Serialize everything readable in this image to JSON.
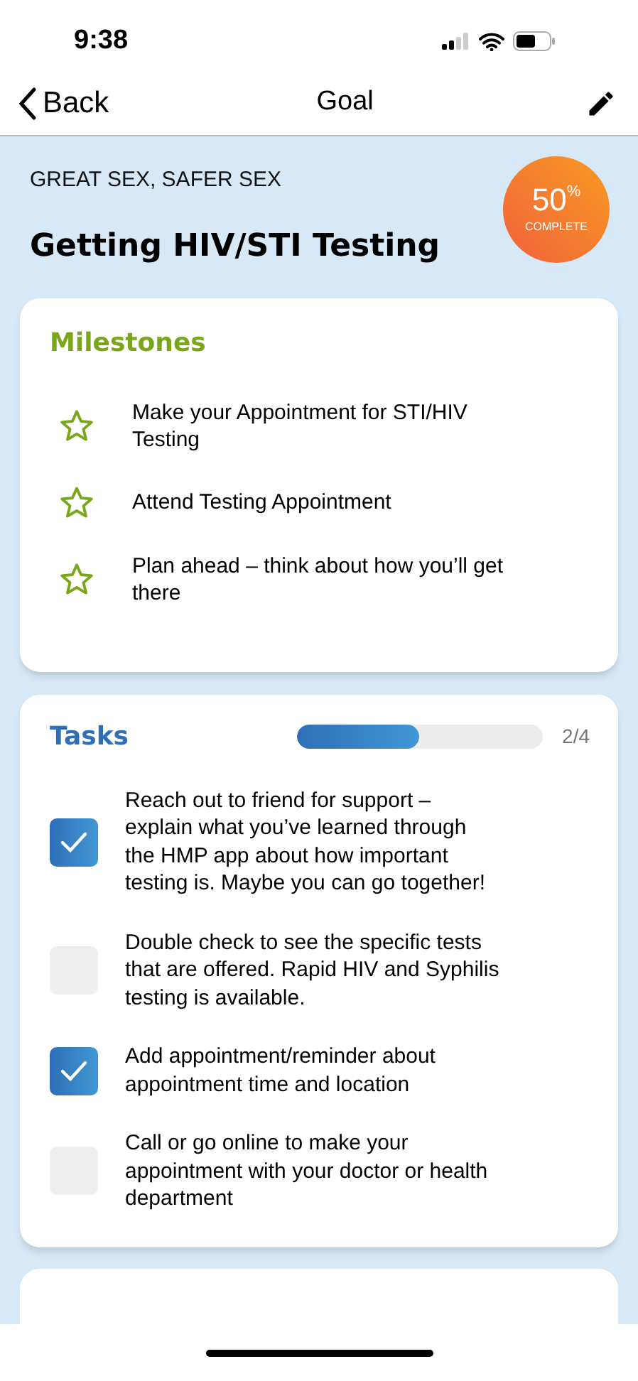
{
  "status_bar": {
    "time": "9:38"
  },
  "nav": {
    "back": "Back",
    "title": "Goal"
  },
  "goal": {
    "category": "GREAT SEX, SAFER SEX",
    "title": "Getting HIV/STI Testing",
    "badge": {
      "value": "50",
      "unit": "%",
      "label": "COMPLETE"
    }
  },
  "milestones": {
    "title": "Milestones",
    "items": [
      {
        "text": "Make your Appointment for STI/HIV Testing"
      },
      {
        "text": "Attend Testing Appointment"
      },
      {
        "text": "Plan ahead – think about how you’ll get there"
      }
    ]
  },
  "tasks": {
    "title": "Tasks",
    "level": 0.5,
    "count": "2/4",
    "items": [
      {
        "text": "Reach out to friend for support – explain what you’ve learned through the HMP app about how important testing is. Maybe you can go together!",
        "checked": true
      },
      {
        "text": "Double check to see the specific tests that are offered. Rapid HIV and Syphilis testing is available.",
        "checked": false
      },
      {
        "text": "Add appointment/reminder about appointment time and location",
        "checked": true
      },
      {
        "text": "Call or go online to make your appointment with your doctor or health department",
        "checked": false
      }
    ]
  }
}
